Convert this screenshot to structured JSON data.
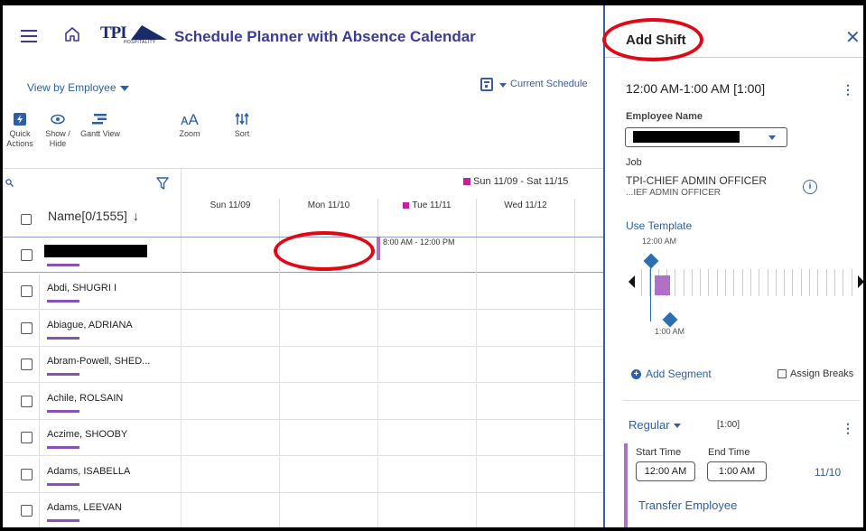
{
  "header": {
    "logo_text": "TPI",
    "logo_sub": "HOSPITALITY",
    "title": "Schedule Planner with Absence Calendar"
  },
  "view_by": "View by Employee",
  "current_schedule": "Current Schedule",
  "toolbar": {
    "quick_actions": "Quick Actions",
    "show_hide": "Show / Hide",
    "gantt_view": "Gantt View",
    "zoom": "Zoom",
    "sort": "Sort"
  },
  "grid": {
    "name_header": "Name[0/1555]",
    "week_range": "Sun 11/09 - Sat 11/15",
    "days": [
      "Sun 11/09",
      "Mon 11/10",
      "Tue 11/11",
      "Wed 11/12"
    ],
    "shift_label": "8:00 AM - 12:00 PM",
    "employees": [
      "Abdi, SHUGRI I",
      "Abiague, ADRIANA",
      "Abram-Powell, SHED...",
      "Achile, ROLSAIN",
      "Aczime, SHOOBY",
      "Adams, ISABELLA",
      "Adams, LEEVAN"
    ]
  },
  "panel": {
    "title": "Add Shift",
    "time_range": "12:00 AM-1:00 AM [1:00]",
    "employee_label": "Employee Name",
    "job_label": "Job",
    "job_title": "TPI-CHIEF ADMIN OFFICER",
    "job_sub": "...IEF ADMIN OFFICER",
    "use_template": "Use Template",
    "timeline_start": "12:00 AM",
    "timeline_end": "1:00 AM",
    "add_segment": "Add Segment",
    "assign_breaks": "Assign Breaks",
    "segment_type": "Regular",
    "segment_duration": "[1:00]",
    "start_label": "Start Time",
    "end_label": "End Time",
    "start_time": "12:00 AM",
    "end_time": "1:00 AM",
    "segment_date": "11/10",
    "transfer": "Transfer Employee"
  },
  "colors": {
    "accent": "#2c5fa8",
    "title": "#3b3b9c",
    "segment": "#b070c8",
    "highlight": "#e30613"
  }
}
